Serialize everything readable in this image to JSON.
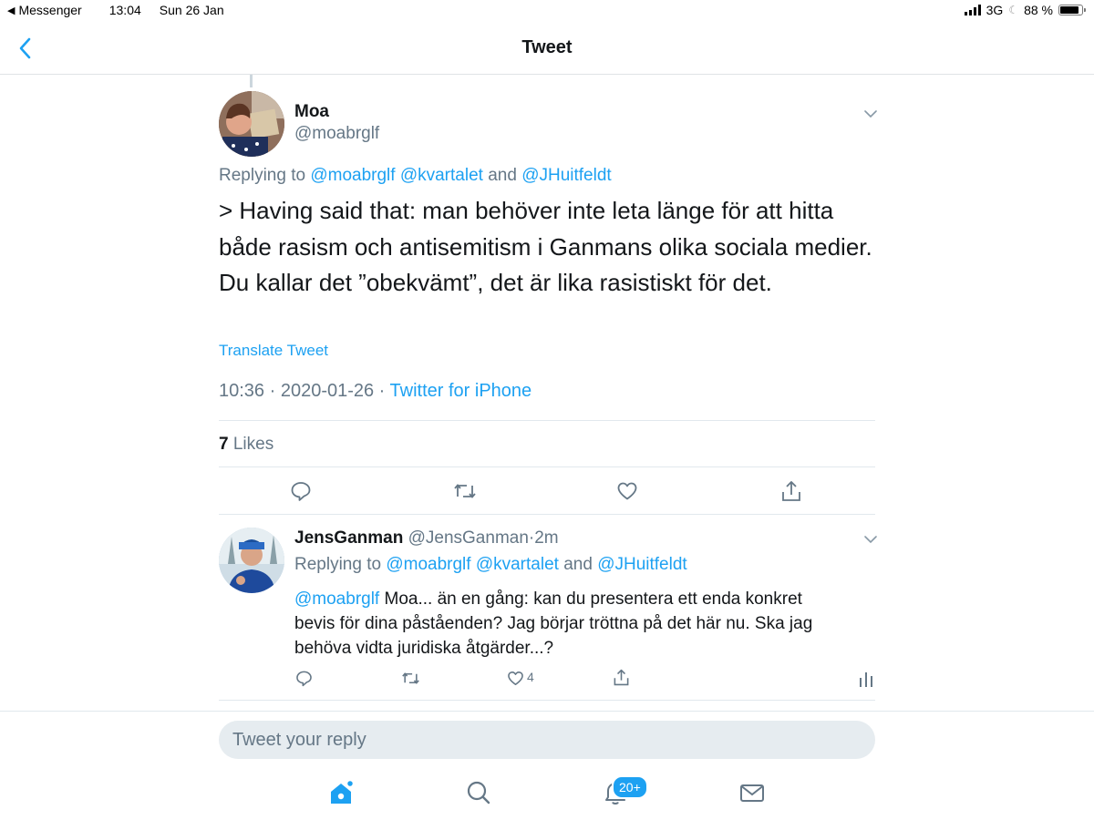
{
  "status_bar": {
    "back_app": "Messenger",
    "time": "13:04",
    "date": "Sun 26 Jan",
    "network": "3G",
    "battery": "88 %",
    "battery_level": 0.88
  },
  "nav": {
    "title": "Tweet",
    "back_icon": "chevron-left-icon"
  },
  "main_tweet": {
    "name": "Moa",
    "handle": "@moabrglf",
    "replying_prefix": "Replying to ",
    "replying_mentions": "@moabrglf @kvartalet",
    "replying_and": " and ",
    "replying_last": "@JHuitfeldt",
    "text_lines": [
      "> Having said that: man behöver inte leta länge för att hitta",
      "både rasism och antisemitism i Ganmans olika sociala medier.",
      "Du kallar det ”obekvämt”, det är lika rasistiskt för det."
    ],
    "translate": "Translate Tweet",
    "timestamp": "10:36 · 2020-01-26 · ",
    "source": "Twitter for iPhone",
    "likes_count": "7",
    "likes_label": " Likes"
  },
  "reply_tweet": {
    "name": "JensGanman",
    "handle": " @JensGanman",
    "dot": "·",
    "time": "2m",
    "replying_prefix": "Replying to ",
    "replying_mentions": "@moabrglf @kvartalet",
    "replying_and": " and ",
    "replying_last": "@JHuitfeldt",
    "mention": "@moabrglf",
    "text_line1": " Moa... än en gång: kan du presentera ett enda konkret",
    "text_line2": "bevis för dina påståenden? Jag börjar tröttna på det här nu. Ska jag",
    "text_line3": "behöva vidta juridiska åtgärder...?",
    "like_count": "4"
  },
  "composer": {
    "placeholder": "Tweet your reply"
  },
  "tab_bar": {
    "notifications_badge": "20+",
    "tabs": [
      "home-icon",
      "search-icon",
      "notifications-bell-icon",
      "messages-mail-icon"
    ]
  },
  "colors": {
    "accent": "#1da1f2",
    "secondary_text": "#657786",
    "primary_text": "#14171a"
  }
}
